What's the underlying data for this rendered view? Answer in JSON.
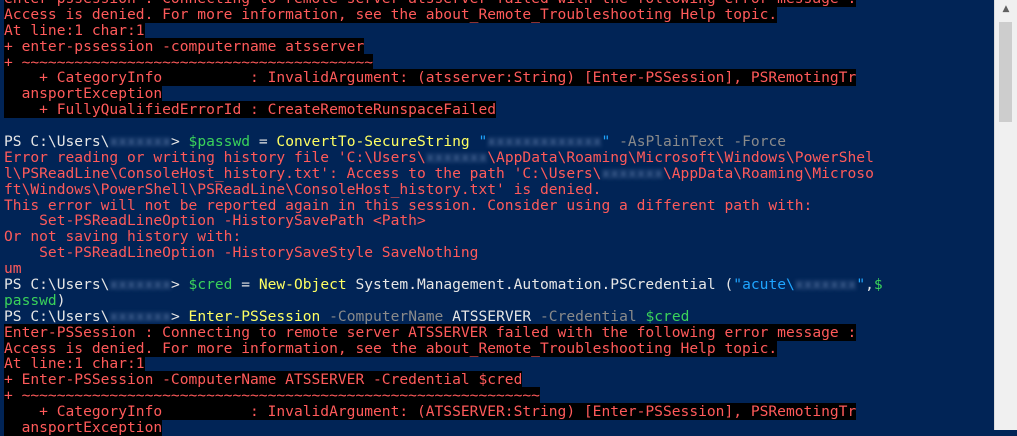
{
  "console": {
    "lines": [
      {
        "cls": "errbg",
        "segs": [
          {
            "c": "errbg",
            "t": "enter-pssession : Connecting to remote server atsserver failed with the following error message :"
          }
        ]
      },
      {
        "cls": "errbg",
        "segs": [
          {
            "c": "errbg",
            "t": "Access is denied. For more information, see the about_Remote_Troubleshooting Help topic."
          }
        ]
      },
      {
        "cls": "errbg",
        "segs": [
          {
            "c": "errbg",
            "t": "At line:1 char:1"
          }
        ]
      },
      {
        "cls": "errbg",
        "segs": [
          {
            "c": "errbg",
            "t": "+ enter-pssession -computername atsserver"
          }
        ]
      },
      {
        "cls": "errbg",
        "segs": [
          {
            "c": "errbg",
            "t": "+ ~~~~~~~~~~~~~~~~~~~~~~~~~~~~~~~~~~~~~~~~"
          }
        ]
      },
      {
        "cls": "errbg",
        "segs": [
          {
            "c": "errbg",
            "t": "    + CategoryInfo          : InvalidArgument: (atsserver:String) [Enter-PSSession], PSRemotingTr"
          }
        ]
      },
      {
        "cls": "errbg",
        "segs": [
          {
            "c": "errbg",
            "t": "  ansportException"
          }
        ]
      },
      {
        "cls": "errbg",
        "segs": [
          {
            "c": "errbg",
            "t": "    + FullyQualifiedErrorId : CreateRemoteRunspaceFailed"
          }
        ]
      },
      {
        "cls": "",
        "segs": [
          {
            "c": "plain",
            "t": " "
          }
        ]
      },
      {
        "cls": "",
        "segs": [
          {
            "c": "plain",
            "t": "PS C:\\Users\\"
          },
          {
            "c": "blur",
            "t": "xxxxxxx"
          },
          {
            "c": "plain",
            "t": "> "
          },
          {
            "c": "var",
            "t": "$passwd"
          },
          {
            "c": "plain",
            "t": " = "
          },
          {
            "c": "cmd",
            "t": "ConvertTo-SecureString"
          },
          {
            "c": "plain",
            "t": " "
          },
          {
            "c": "str",
            "t": "\""
          },
          {
            "c": "blur",
            "t": "xxxxxxxxxxxxx"
          },
          {
            "c": "str",
            "t": "\""
          },
          {
            "c": "plain",
            "t": " "
          },
          {
            "c": "param",
            "t": "-AsPlainText -Force"
          }
        ]
      },
      {
        "cls": "",
        "segs": [
          {
            "c": "err",
            "t": "Error reading or writing history file 'C:\\Users\\"
          },
          {
            "c": "blur",
            "t": "xxxxxxx"
          },
          {
            "c": "err",
            "t": "\\AppData\\Roaming\\Microsoft\\Windows\\PowerShel"
          }
        ]
      },
      {
        "cls": "",
        "segs": [
          {
            "c": "err",
            "t": "l\\PSReadLine\\ConsoleHost_history.txt': Access to the path 'C:\\Users\\"
          },
          {
            "c": "blur",
            "t": "xxxxxxx"
          },
          {
            "c": "err",
            "t": "\\AppData\\Roaming\\Microso"
          }
        ]
      },
      {
        "cls": "",
        "segs": [
          {
            "c": "err",
            "t": "ft\\Windows\\PowerShell\\PSReadLine\\ConsoleHost_history.txt' is denied."
          }
        ]
      },
      {
        "cls": "",
        "segs": [
          {
            "c": "err",
            "t": "This error will not be reported again in this session. Consider using a different path with:"
          }
        ]
      },
      {
        "cls": "",
        "segs": [
          {
            "c": "err",
            "t": "    Set-PSReadLineOption -HistorySavePath <Path>"
          }
        ]
      },
      {
        "cls": "",
        "segs": [
          {
            "c": "err",
            "t": "Or not saving history with:"
          }
        ]
      },
      {
        "cls": "",
        "segs": [
          {
            "c": "err",
            "t": "    Set-PSReadLineOption -HistorySaveStyle SaveNothing"
          }
        ]
      },
      {
        "cls": "",
        "segs": [
          {
            "c": "err",
            "t": "um"
          }
        ]
      },
      {
        "cls": "",
        "segs": [
          {
            "c": "plain",
            "t": "PS C:\\Users\\"
          },
          {
            "c": "blur",
            "t": "xxxxxxx"
          },
          {
            "c": "plain",
            "t": "> "
          },
          {
            "c": "var",
            "t": "$cred"
          },
          {
            "c": "plain",
            "t": " = "
          },
          {
            "c": "cmd",
            "t": "New-Object"
          },
          {
            "c": "plain",
            "t": " System.Management.Automation.PSCredential ("
          },
          {
            "c": "str",
            "t": "\"acute\\"
          },
          {
            "c": "blur",
            "t": "xxxxxxx"
          },
          {
            "c": "str",
            "t": "\""
          },
          {
            "c": "plain",
            "t": ","
          },
          {
            "c": "var",
            "t": "$"
          }
        ]
      },
      {
        "cls": "",
        "segs": [
          {
            "c": "var",
            "t": "passwd"
          },
          {
            "c": "plain",
            "t": ")"
          }
        ]
      },
      {
        "cls": "",
        "segs": [
          {
            "c": "plain",
            "t": "PS C:\\Users\\"
          },
          {
            "c": "blur",
            "t": "xxxxxxx"
          },
          {
            "c": "plain",
            "t": "> "
          },
          {
            "c": "cmd",
            "t": "Enter-PSSession"
          },
          {
            "c": "plain",
            "t": " "
          },
          {
            "c": "param",
            "t": "-ComputerName"
          },
          {
            "c": "plain",
            "t": " ATSSERVER "
          },
          {
            "c": "param",
            "t": "-Credential"
          },
          {
            "c": "plain",
            "t": " "
          },
          {
            "c": "var",
            "t": "$cred"
          }
        ]
      },
      {
        "cls": "errbg",
        "segs": [
          {
            "c": "errbg",
            "t": "Enter-PSSession : Connecting to remote server ATSSERVER failed with the following error message :"
          }
        ]
      },
      {
        "cls": "errbg",
        "segs": [
          {
            "c": "errbg",
            "t": "Access is denied. For more information, see the about_Remote_Troubleshooting Help topic."
          }
        ]
      },
      {
        "cls": "errbg",
        "segs": [
          {
            "c": "errbg",
            "t": "At line:1 char:1"
          }
        ]
      },
      {
        "cls": "errbg",
        "segs": [
          {
            "c": "errbg",
            "t": "+ Enter-PSSession -ComputerName ATSSERVER -Credential $cred"
          }
        ]
      },
      {
        "cls": "errbg",
        "segs": [
          {
            "c": "errbg",
            "t": "+ ~~~~~~~~~~~~~~~~~~~~~~~~~~~~~~~~~~~~~~~~~~~~~~~~~~~~~~~~~~~"
          }
        ]
      },
      {
        "cls": "errbg",
        "segs": [
          {
            "c": "errbg",
            "t": "    + CategoryInfo          : InvalidArgument: (ATSSERVER:String) [Enter-PSSession], PSRemotingTr"
          }
        ]
      },
      {
        "cls": "errbg",
        "segs": [
          {
            "c": "errbg",
            "t": "  ansportException"
          }
        ]
      }
    ]
  },
  "scrollbar": {
    "up_arrow": "▲"
  }
}
